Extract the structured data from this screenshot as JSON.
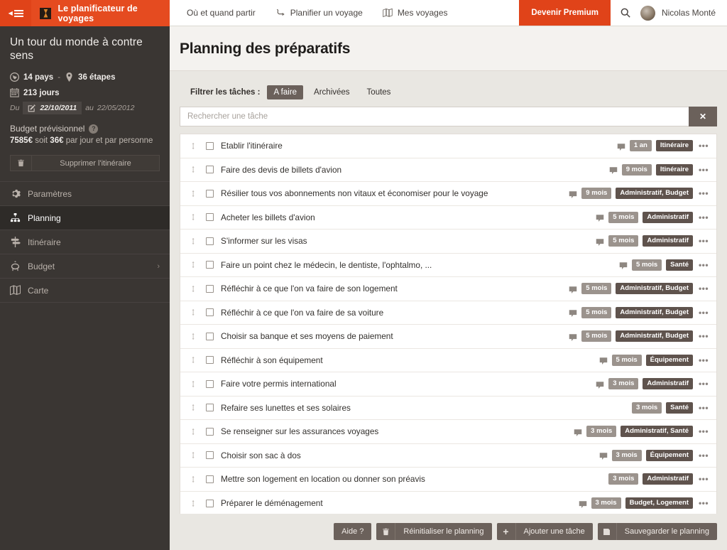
{
  "sidebar": {
    "brand": {
      "title": "Le planificateur de voyages",
      "collapse_icon": "collapse-menu-icon",
      "logo_icon": "app-logo-icon"
    },
    "trip": {
      "title": "Un tour du monde à contre sens",
      "countries": "14 pays",
      "separator": "-",
      "steps": "36 étapes",
      "days": "213 jours",
      "date_prefix": "Du",
      "date_start": "22/10/2011",
      "date_middle": "au",
      "date_end": "22/05/2012",
      "budget_label": "Budget prévisionnel",
      "help_glyph": "?",
      "budget_total": "7585€",
      "budget_mid": "soit",
      "budget_per": "36€",
      "budget_suffix": "par jour et par personne",
      "delete_label": "Supprimer l'itinéraire"
    },
    "items": [
      {
        "label": "Paramètres",
        "icon": "gear-icon",
        "active": false,
        "chevron": ""
      },
      {
        "label": "Planning",
        "icon": "sitemap-icon",
        "active": true,
        "chevron": ""
      },
      {
        "label": "Itinéraire",
        "icon": "signpost-icon",
        "active": false,
        "chevron": ""
      },
      {
        "label": "Budget",
        "icon": "piggy-bank-icon",
        "active": false,
        "chevron": "›"
      },
      {
        "label": "Carte",
        "icon": "map-icon",
        "active": false,
        "chevron": ""
      }
    ]
  },
  "topbar": {
    "links": [
      {
        "label": "Où et quand partir",
        "icon": ""
      },
      {
        "label": "Planifier un voyage",
        "icon": "route-icon"
      },
      {
        "label": "Mes voyages",
        "icon": "map-icon"
      }
    ],
    "premium_label": "Devenir Premium",
    "search_icon": "search-icon",
    "user_name": "Nicolas Monté",
    "avatar": "user-avatar"
  },
  "page": {
    "title": "Planning des préparatifs"
  },
  "filter": {
    "label": "Filtrer les tâches :",
    "tabs": [
      {
        "label": "A faire",
        "active": true
      },
      {
        "label": "Archivées",
        "active": false
      },
      {
        "label": "Toutes",
        "active": false
      }
    ]
  },
  "search": {
    "placeholder": "Rechercher une tâche",
    "value": "",
    "clear_label": "✕"
  },
  "tasks": [
    {
      "text": "Etablir l'itinéraire",
      "comment": true,
      "duration": "1 an",
      "category": "Itinéraire"
    },
    {
      "text": "Faire des devis de billets d'avion",
      "comment": true,
      "duration": "9 mois",
      "category": "Itinéraire"
    },
    {
      "text": "Résilier tous vos abonnements non vitaux et économiser pour le voyage",
      "comment": true,
      "duration": "9 mois",
      "category": "Administratif, Budget"
    },
    {
      "text": "Acheter les billets d'avion",
      "comment": true,
      "duration": "5 mois",
      "category": "Administratif"
    },
    {
      "text": "S'informer sur les visas",
      "comment": true,
      "duration": "5 mois",
      "category": "Administratif"
    },
    {
      "text": "Faire un point chez le médecin, le dentiste, l'ophtalmo, ...",
      "comment": true,
      "duration": "5 mois",
      "category": "Santé"
    },
    {
      "text": "Réfléchir à ce que l'on va faire de son logement",
      "comment": true,
      "duration": "5 mois",
      "category": "Administratif, Budget"
    },
    {
      "text": "Réfléchir à ce que l'on va faire de sa voiture",
      "comment": true,
      "duration": "5 mois",
      "category": "Administratif, Budget"
    },
    {
      "text": "Choisir sa banque et ses moyens de paiement",
      "comment": true,
      "duration": "5 mois",
      "category": "Administratif, Budget"
    },
    {
      "text": "Réfléchir à son équipement",
      "comment": true,
      "duration": "5 mois",
      "category": "Équipement"
    },
    {
      "text": "Faire votre permis international",
      "comment": true,
      "duration": "3 mois",
      "category": "Administratif"
    },
    {
      "text": "Refaire ses lunettes et ses solaires",
      "comment": false,
      "duration": "3 mois",
      "category": "Santé"
    },
    {
      "text": "Se renseigner sur les assurances voyages",
      "comment": true,
      "duration": "3 mois",
      "category": "Administratif, Santé"
    },
    {
      "text": "Choisir son sac à dos",
      "comment": true,
      "duration": "3 mois",
      "category": "Équipement"
    },
    {
      "text": "Mettre son logement en location ou donner son préavis",
      "comment": false,
      "duration": "3 mois",
      "category": "Administratif"
    },
    {
      "text": "Préparer le déménagement",
      "comment": true,
      "duration": "3 mois",
      "category": "Budget, Logement"
    }
  ],
  "task_menu_glyph": "•••",
  "footer": {
    "buttons": [
      {
        "label": "Aide ?",
        "icon": ""
      },
      {
        "label": "Réinitialiser le planning",
        "icon": "trash-icon"
      },
      {
        "label": "Ajouter une tâche",
        "icon": "plus-icon"
      },
      {
        "label": "Sauvegarder le planning",
        "icon": "save-icon"
      }
    ]
  },
  "colors": {
    "accent": "#e04319",
    "sidebar": "#3a3633",
    "badge_duration": "#9b938d",
    "badge_category": "#5f534d",
    "page_bg": "#e9e7e2"
  }
}
